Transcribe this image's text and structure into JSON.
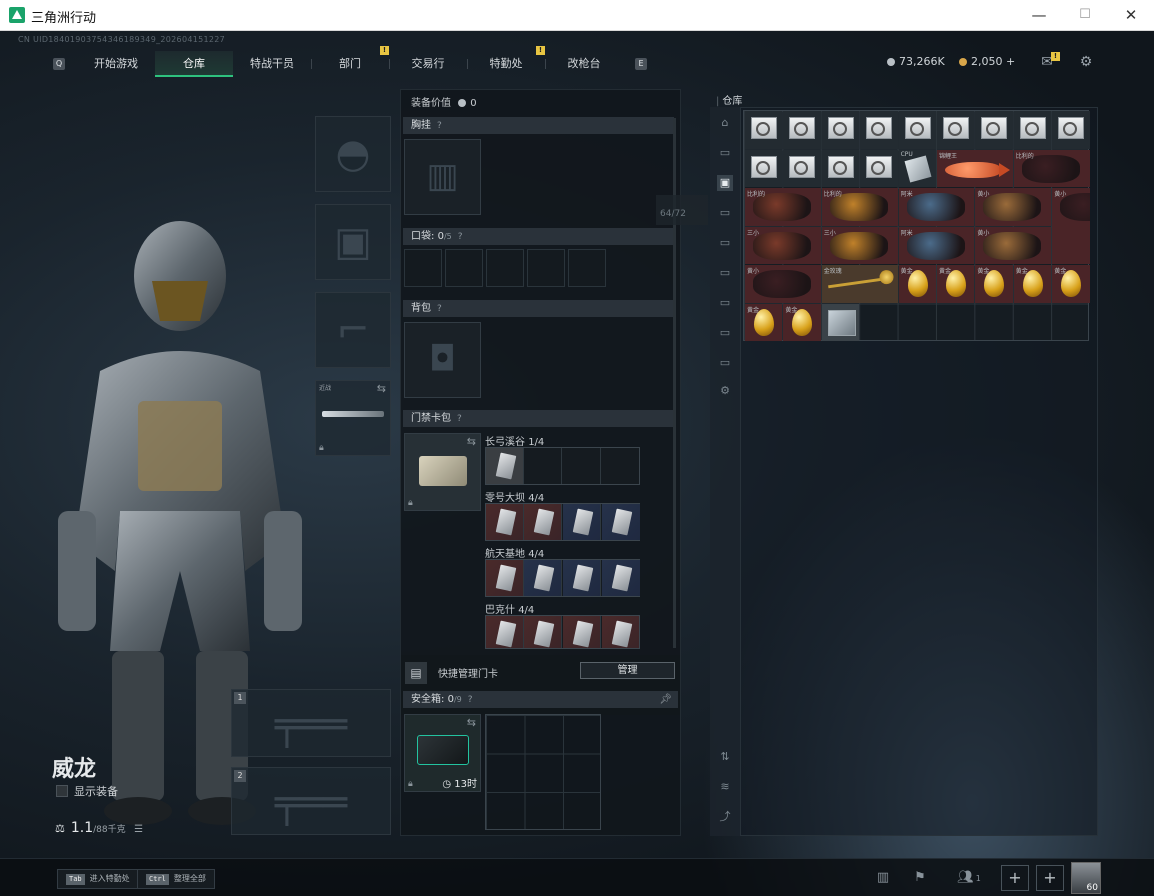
{
  "window": {
    "title": "三角洲行动",
    "minimize": "—",
    "maximize": "☐",
    "close": "✕"
  },
  "uid": "CN UID18401903754346189349_202604151227",
  "nav": {
    "left_key": "Q",
    "right_key": "E",
    "tabs": [
      "开始游戏",
      "仓库",
      "特战干员",
      "部门",
      "交易行",
      "特勤处",
      "改枪台"
    ],
    "active_tab": "仓库",
    "badge": "!"
  },
  "currency": {
    "silver": "73,266K",
    "gold": "2,050",
    "gold_plus": "+",
    "silver_color": "#b9c0c6",
    "gold_color": "#d8a64a"
  },
  "top_icons": {
    "mail": "mail-icon",
    "settings": "gear-icon",
    "mail_badge": "!"
  },
  "operator": {
    "name": "威龙",
    "show_equipment_label": "显示装备",
    "weight_value": "1.1",
    "weight_max": "/88千克"
  },
  "weapon_slots": {
    "melee_tag": "近战",
    "slot1": "1",
    "slot2": "2"
  },
  "equipment": {
    "value_label": "装备价值",
    "value": "0",
    "chest_rig": "胸挂",
    "pockets_label": "口袋:",
    "pockets_used": "0",
    "pockets_total": "/5",
    "backpack": "背包",
    "keycard_case": "门禁卡包",
    "help": "?",
    "card_groups": [
      {
        "name": "长弓溪谷",
        "count": "1/4"
      },
      {
        "name": "零号大坝",
        "count": "4/4"
      },
      {
        "name": "航天基地",
        "count": "4/4"
      },
      {
        "name": "巴克什",
        "count": "4/4"
      }
    ],
    "quick_manage_label": "快捷管理门卡",
    "manage_button": "管理",
    "safe_box_label": "安全箱:",
    "safe_box_used": "0",
    "safe_box_total": "/9",
    "safe_box_timer": "13时"
  },
  "stash": {
    "title": "仓库",
    "tooltip": "64/72",
    "items": [
      {
        "label": "",
        "kind": "gpu",
        "tone": "dark"
      },
      {
        "label": "CPU",
        "kind": "chip",
        "tone": "dark"
      },
      {
        "label": "锦鲤王",
        "kind": "fish",
        "tone": "maroon"
      },
      {
        "label": "比利的",
        "kind": "figure",
        "tone": "maroon"
      },
      {
        "label": "三小",
        "kind": "figure",
        "tone": "maroon"
      },
      {
        "label": "阿米",
        "kind": "figure",
        "tone": "maroon"
      },
      {
        "label": "黄小",
        "kind": "figure",
        "tone": "maroon"
      },
      {
        "label": "金玫瑰",
        "kind": "rose",
        "tone": "brown"
      },
      {
        "label": "黄金",
        "kind": "egg",
        "tone": "maroon"
      }
    ]
  },
  "bottom": {
    "hint1_key": "Tab",
    "hint1_text": "进入特勤处",
    "hint2_key": "Ctrl",
    "hint2_text": "整理全部",
    "friends_count": "1",
    "avatar_level": "60"
  }
}
